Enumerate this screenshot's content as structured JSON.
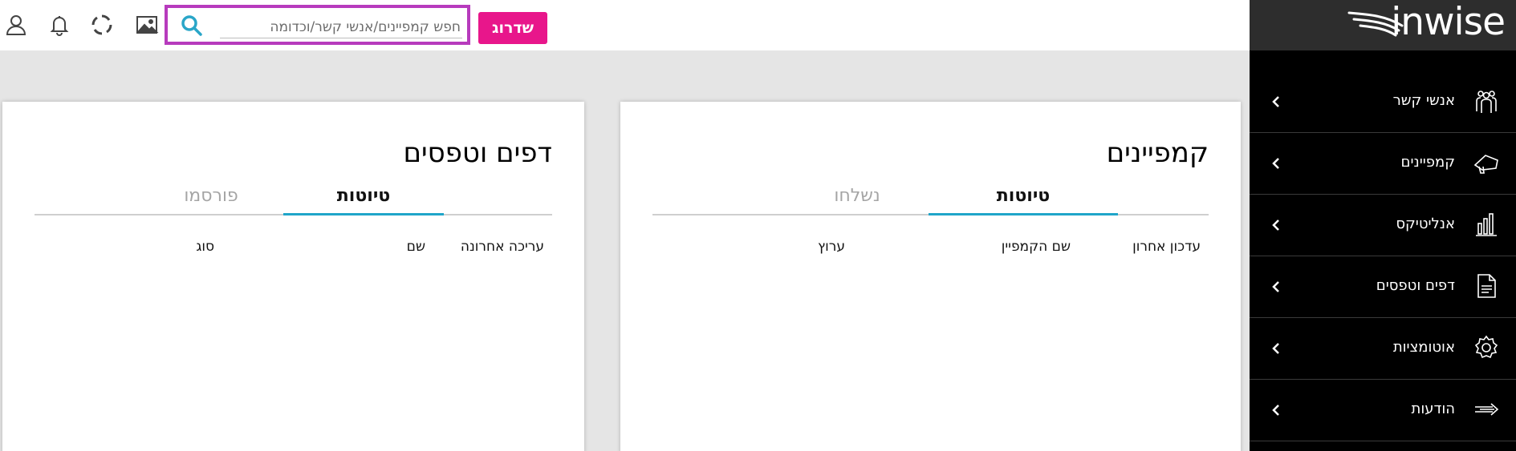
{
  "topbar": {
    "search_placeholder": "חפש קמפיינים/אנשי קשר/וכדומה",
    "upgrade_label": "שדרוג",
    "icons": [
      "user-icon",
      "bell-icon",
      "refresh-icon",
      "image-icon",
      "search-icon"
    ]
  },
  "logo": {
    "text": "inwise"
  },
  "sidebar": {
    "items": [
      {
        "label": "אנשי קשר",
        "icon": "contacts-icon"
      },
      {
        "label": "קמפיינים",
        "icon": "megaphone-icon"
      },
      {
        "label": "אנליטיקס",
        "icon": "analytics-icon"
      },
      {
        "label": "דפים וטפסים",
        "icon": "document-icon"
      },
      {
        "label": "אוטומציות",
        "icon": "gear-icon"
      },
      {
        "label": "הודעות",
        "icon": "arrow-icon"
      }
    ]
  },
  "campaigns_card": {
    "title": "קמפיינים",
    "tabs": {
      "active": "טיוטות",
      "inactive": "נשלחו"
    },
    "columns": [
      "עדכון אחרון",
      "שם הקמפיין",
      "ערוץ"
    ]
  },
  "pages_card": {
    "title": "דפים וטפסים",
    "tabs": {
      "active": "טיוטות",
      "inactive": "פורסמו"
    },
    "columns": [
      "עריכה אחרונה",
      "שם",
      "סוג"
    ]
  },
  "colors": {
    "accent_pink": "#e8168b",
    "search_border": "#b73bbd",
    "tab_underline": "#1fa5c9",
    "sidebar_bg": "#000000"
  }
}
